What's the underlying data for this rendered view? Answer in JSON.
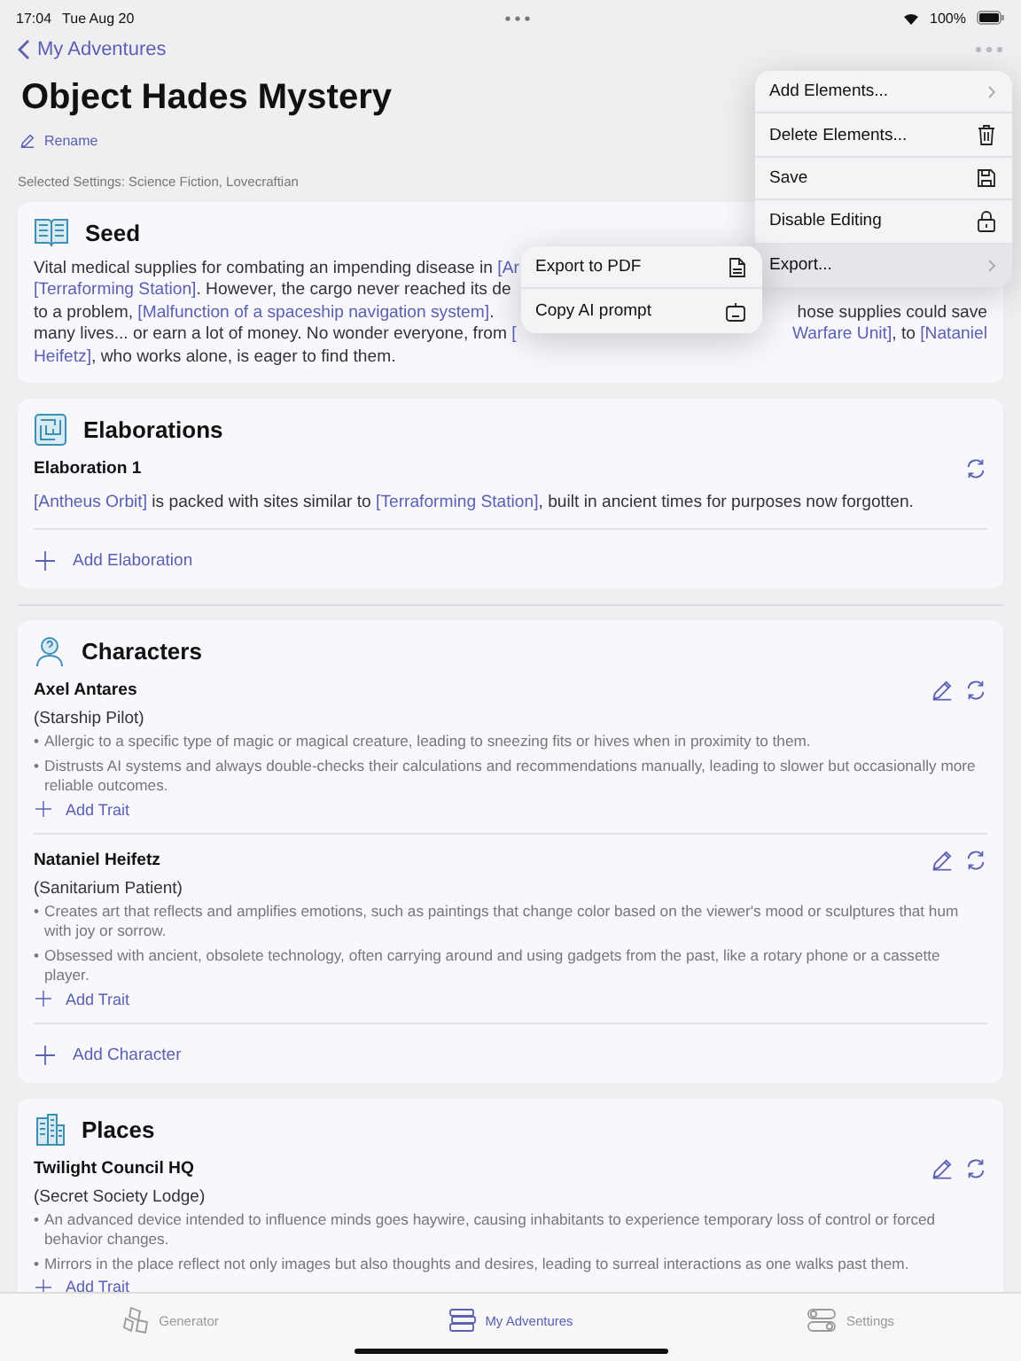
{
  "status_bar": {
    "time": "17:04",
    "date": "Tue Aug 20",
    "battery": "100%"
  },
  "nav": {
    "back": "My Adventures"
  },
  "title": "Object Hades Mystery",
  "rename": "Rename",
  "settings_line": "Selected Settings: Science Fiction, Lovecraftian",
  "seed": {
    "title": "Seed",
    "lines": [
      {
        "left": [
          {
            "text": "Vital medical supplies for combating an impending disease in ",
            "link": false
          },
          {
            "text": "[Ar",
            "link": true
          }
        ]
      },
      {
        "left": [
          {
            "text": "[Terraforming Station]",
            "link": true
          },
          {
            "text": ". However, the cargo never reached its de",
            "link": false
          }
        ]
      },
      {
        "left": [
          {
            "text": "to a problem, ",
            "link": false
          },
          {
            "text": "[Malfunction of a spaceship navigation system]",
            "link": true
          },
          {
            "text": ".",
            "link": false
          }
        ],
        "right": [
          {
            "text": "hose supplies could save",
            "link": false
          }
        ]
      },
      {
        "left": [
          {
            "text": "many lives... or earn a lot of money. No wonder everyone, from ",
            "link": false
          },
          {
            "text": "[",
            "link": true
          }
        ],
        "right": [
          {
            "text": "Warfare Unit]",
            "link": true
          },
          {
            "text": ", to ",
            "link": false
          },
          {
            "text": "[Nataniel",
            "link": true
          }
        ]
      },
      {
        "left": [
          {
            "text": "Heifetz]",
            "link": true
          },
          {
            "text": ", who works alone, is eager to find them.",
            "link": false
          }
        ]
      }
    ]
  },
  "elaborations": {
    "title": "Elaborations",
    "items": [
      {
        "name": "Elaboration 1",
        "text": [
          {
            "text": "[Antheus Orbit]",
            "link": true
          },
          {
            "text": " is packed with sites similar to ",
            "link": false
          },
          {
            "text": "[Terraforming Station]",
            "link": true
          },
          {
            "text": ", built in ancient times for purposes now forgotten.",
            "link": false
          }
        ]
      }
    ],
    "add": "Add Elaboration"
  },
  "characters": {
    "title": "Characters",
    "items": [
      {
        "name": "Axel Antares",
        "role": "(Starship Pilot)",
        "traits": [
          {
            "bullet": "•",
            "text": "Allergic to a specific type of magic or magical creature, leading to sneezing fits or hives when in proximity to them."
          },
          {
            "bullet": "•",
            "text": "Distrusts AI systems and always double-checks their calculations and recommendations manually, leading to slower but occasionally more reliable outcomes."
          }
        ],
        "add": "Add Trait"
      },
      {
        "name": "Nataniel Heifetz",
        "role": "(Sanitarium Patient)",
        "traits": [
          {
            "bullet": "•",
            "text": "Creates art that reflects and amplifies emotions, such as paintings that change color based on the viewer's mood or sculptures that hum with joy or sorrow."
          },
          {
            "bullet": "•",
            "text": "Obsessed with ancient, obsolete technology, often carrying around and using gadgets from the past, like a rotary phone or a cassette player."
          }
        ],
        "add": "Add Trait"
      }
    ],
    "add": "Add Character"
  },
  "places": {
    "title": "Places",
    "items": [
      {
        "name": "Twilight Council HQ",
        "role": "(Secret Society Lodge)",
        "traits": [
          {
            "bullet": "•",
            "text": "An advanced device intended to influence minds goes haywire, causing inhabitants to experience temporary loss of control or forced behavior changes."
          },
          {
            "bullet": "•",
            "text": "Mirrors in the place reflect not only images but also thoughts and desires, leading to surreal interactions as one walks past them."
          }
        ],
        "add": "Add Trait"
      }
    ]
  },
  "menu": {
    "items": [
      {
        "label": "Add Elements...",
        "kind": "submenu",
        "selected": false
      },
      {
        "label": "Delete Elements...",
        "kind": "trash",
        "selected": false
      },
      {
        "label": "Save",
        "kind": "save",
        "selected": false
      },
      {
        "label": "Disable Editing",
        "kind": "lock",
        "selected": false
      },
      {
        "label": "Export...",
        "kind": "submenu",
        "selected": true
      }
    ]
  },
  "submenu": {
    "items": [
      {
        "label": "Export to PDF",
        "kind": "pdf"
      },
      {
        "label": "Copy AI prompt",
        "kind": "robot"
      }
    ]
  },
  "tab_bar": {
    "tabs": [
      {
        "label": "Generator",
        "kind": "dice",
        "selected": false
      },
      {
        "label": "My Adventures",
        "kind": "books",
        "selected": true
      },
      {
        "label": "Settings",
        "kind": "toggles",
        "selected": false
      }
    ]
  }
}
